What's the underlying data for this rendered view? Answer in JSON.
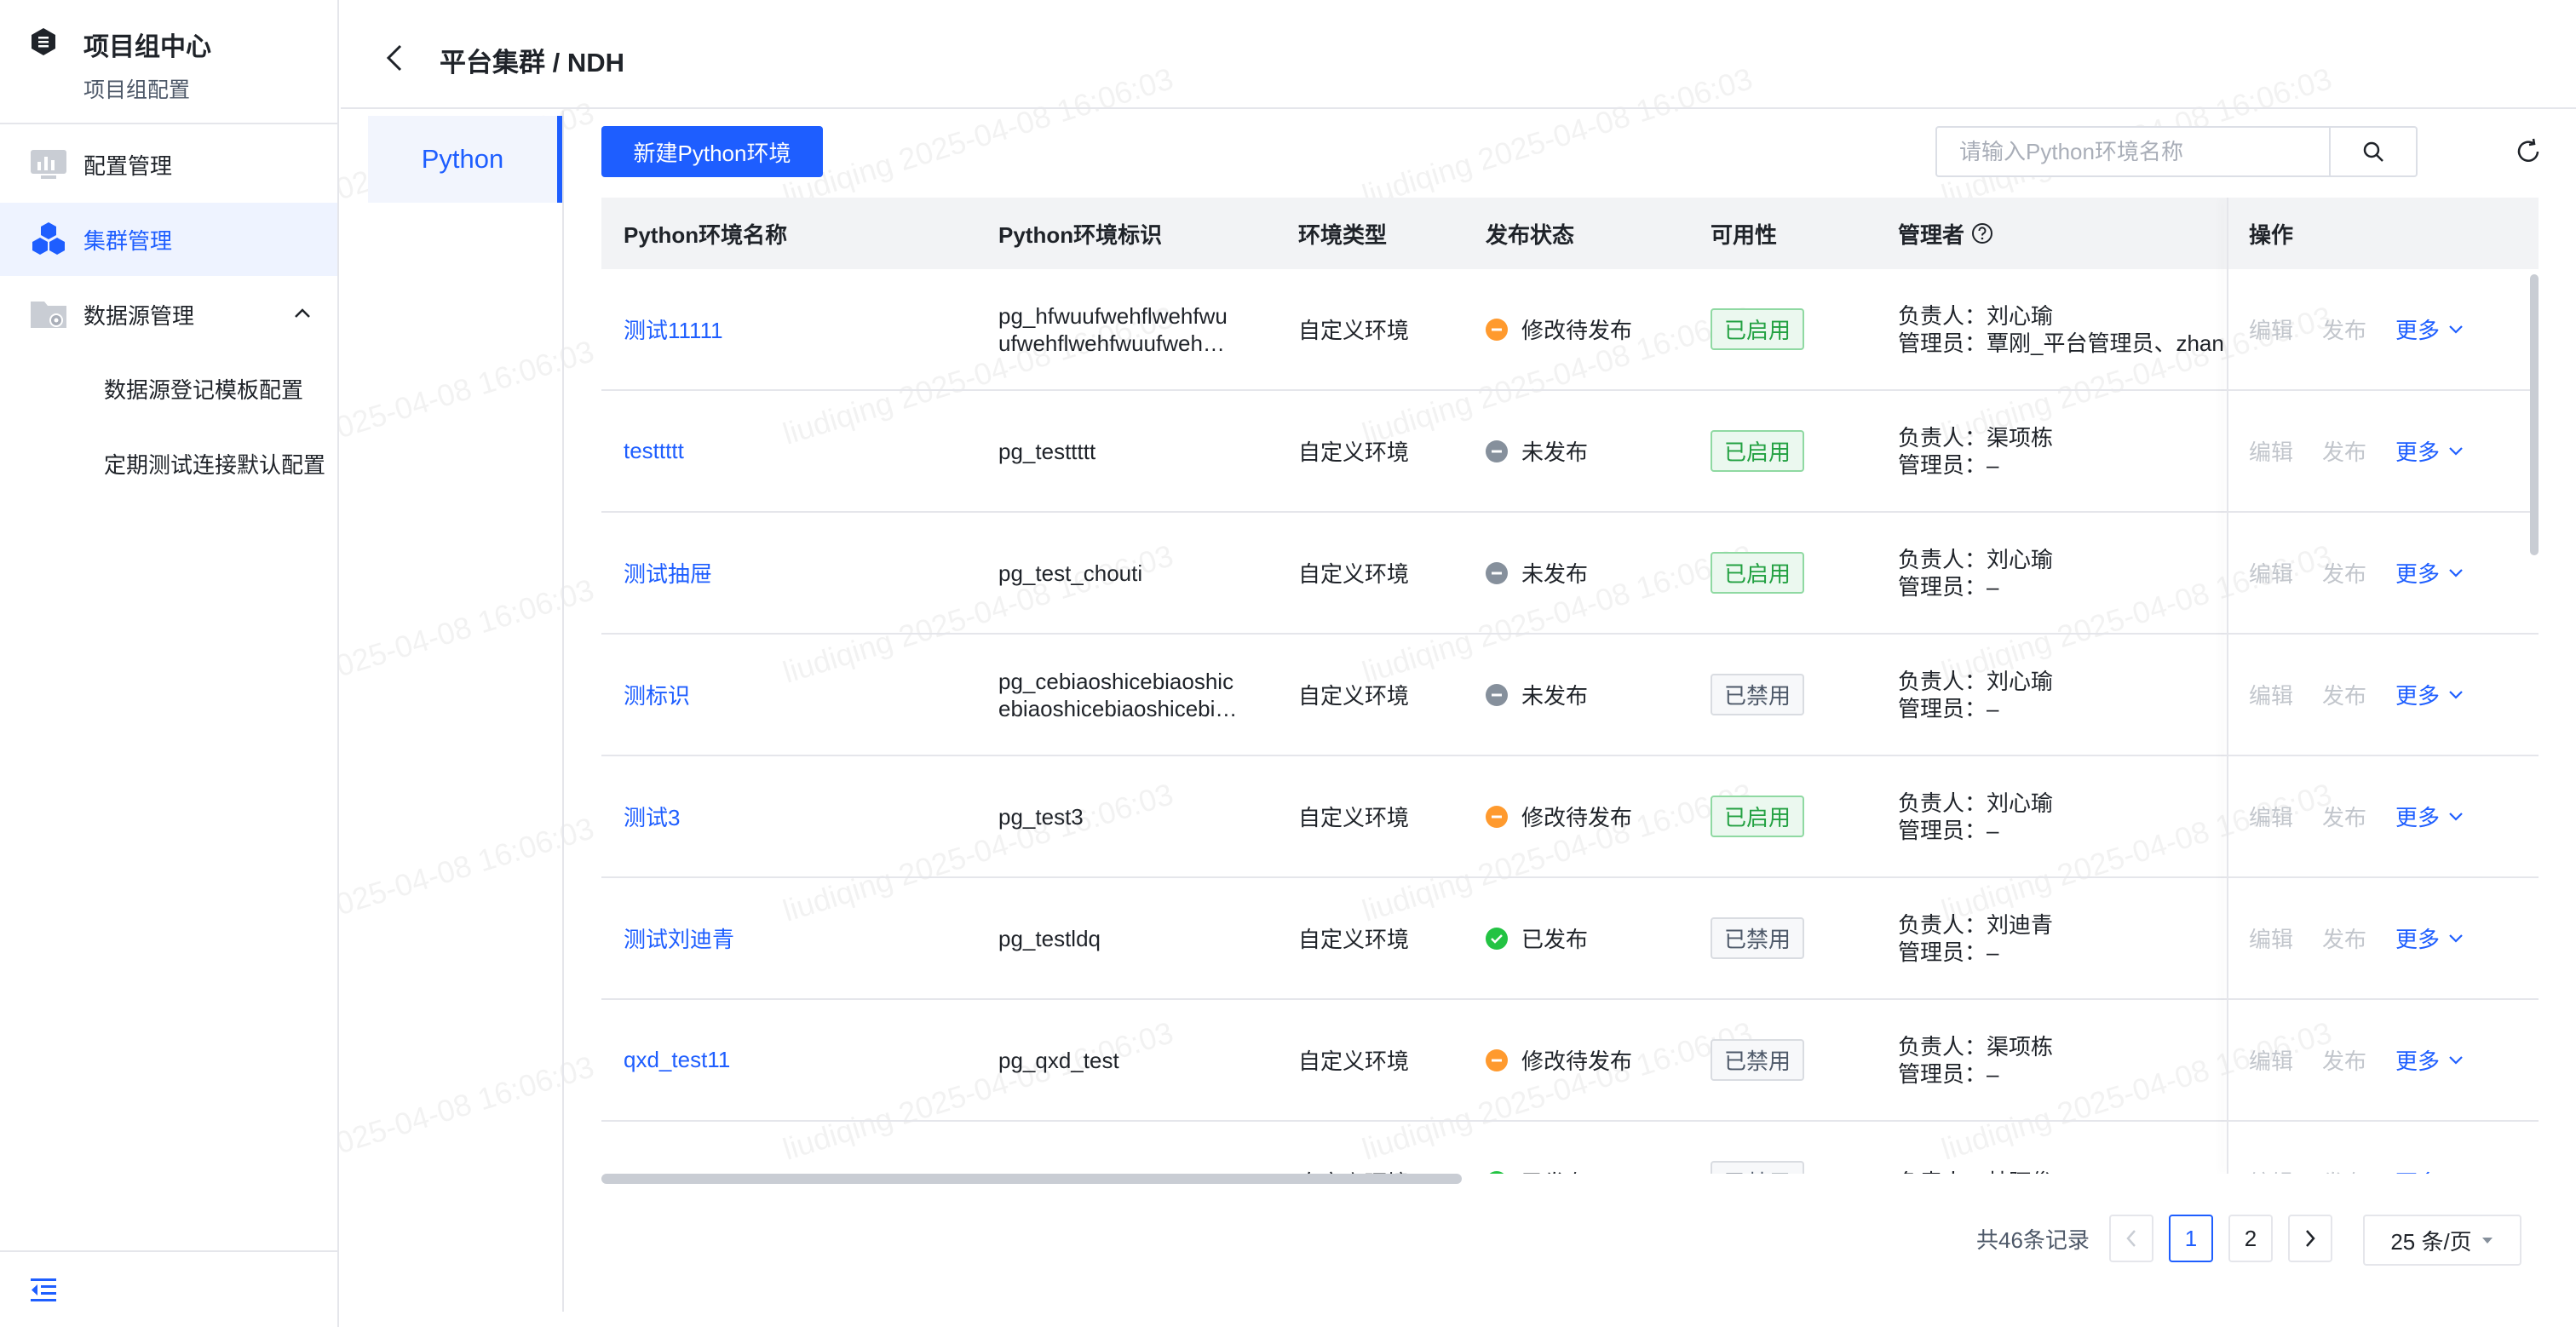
{
  "sidebar": {
    "title": "项目组中心",
    "subtitle": "项目组配置",
    "items": [
      {
        "label": "配置管理",
        "icon": "monitor-chart-icon"
      },
      {
        "label": "集群管理",
        "icon": "cluster-cubes-icon"
      },
      {
        "label": "数据源管理",
        "icon": "folder-gear-icon"
      }
    ],
    "sub_items": [
      "数据源登记模板配置",
      "定期测试连接默认配置"
    ]
  },
  "header": {
    "breadcrumb": "平台集群 / NDH"
  },
  "tabs": [
    "Python"
  ],
  "toolbar": {
    "new_button": "新建Python环境",
    "search_placeholder": "请输入Python环境名称"
  },
  "table": {
    "columns": [
      "Python环境名称",
      "Python环境标识",
      "环境类型",
      "发布状态",
      "可用性",
      "管理者",
      "操作"
    ],
    "rows": [
      {
        "name": "测试11111",
        "id_line1": "pg_hfwuufwehflwehfwu",
        "id_line2": "ufwehflwehfwuufweh…",
        "type": "自定义环境",
        "status": "修改待发布",
        "status_color": "#ff9a2e",
        "avail": "已启用",
        "avail_on": true,
        "owner": "负责人：刘心瑜",
        "admin": "管理员：覃刚_平台管理员、zhan",
        "op_edit": "编辑",
        "op_publish": "发布",
        "op_more": "更多"
      },
      {
        "name": "testtttt",
        "id_line1": "pg_testtttt",
        "id_line2": "",
        "type": "自定义环境",
        "status": "未发布",
        "status_color": "#86909c",
        "avail": "已启用",
        "avail_on": true,
        "owner": "负责人：渠项栋",
        "admin": "管理员：–",
        "op_edit": "编辑",
        "op_publish": "发布",
        "op_more": "更多"
      },
      {
        "name": "测试抽屉",
        "id_line1": "pg_test_chouti",
        "id_line2": "",
        "type": "自定义环境",
        "status": "未发布",
        "status_color": "#86909c",
        "avail": "已启用",
        "avail_on": true,
        "owner": "负责人：刘心瑜",
        "admin": "管理员：–",
        "op_edit": "编辑",
        "op_publish": "发布",
        "op_more": "更多"
      },
      {
        "name": "测标识",
        "id_line1": "pg_cebiaoshicebiaoshic",
        "id_line2": "ebiaoshicebiaoshicebi…",
        "type": "自定义环境",
        "status": "未发布",
        "status_color": "#86909c",
        "avail": "已禁用",
        "avail_on": false,
        "owner": "负责人：刘心瑜",
        "admin": "管理员：–",
        "op_edit": "编辑",
        "op_publish": "发布",
        "op_more": "更多"
      },
      {
        "name": "测试3",
        "id_line1": "pg_test3",
        "id_line2": "",
        "type": "自定义环境",
        "status": "修改待发布",
        "status_color": "#ff9a2e",
        "avail": "已启用",
        "avail_on": true,
        "owner": "负责人：刘心瑜",
        "admin": "管理员：–",
        "op_edit": "编辑",
        "op_publish": "发布",
        "op_more": "更多"
      },
      {
        "name": "测试刘迪青",
        "id_line1": "pg_testldq",
        "id_line2": "",
        "type": "自定义环境",
        "status": "已发布",
        "status_color": "#23c343",
        "avail": "已禁用",
        "avail_on": false,
        "owner": "负责人：刘迪青",
        "admin": "管理员：–",
        "op_edit": "编辑",
        "op_publish": "发布",
        "op_more": "更多"
      },
      {
        "name": "qxd_test11",
        "id_line1": "pg_qxd_test",
        "id_line2": "",
        "type": "自定义环境",
        "status": "修改待发布",
        "status_color": "#ff9a2e",
        "avail": "已禁用",
        "avail_on": false,
        "owner": "负责人：渠项栋",
        "admin": "管理员：–",
        "op_edit": "编辑",
        "op_publish": "发布",
        "op_more": "更多"
      },
      {
        "name": "",
        "id_line1": "",
        "id_line2": "",
        "type": "自定义环境",
        "status": "已发布",
        "status_color": "#23c343",
        "avail": "已禁用",
        "avail_on": false,
        "owner": "负责人：林阿俊",
        "admin": "",
        "op_edit": "编辑",
        "op_publish": "发布",
        "op_more": "更多"
      }
    ]
  },
  "pagination": {
    "total": "共46条记录",
    "pages": [
      "1",
      "2"
    ],
    "current": "1",
    "page_size": "25 条/页"
  },
  "watermark": "liudiqing 2025-04-08 16:06:03",
  "colors": {
    "primary": "#1e5eff",
    "success": "#23a142",
    "warning": "#ff9a2e",
    "muted": "#86909c"
  }
}
